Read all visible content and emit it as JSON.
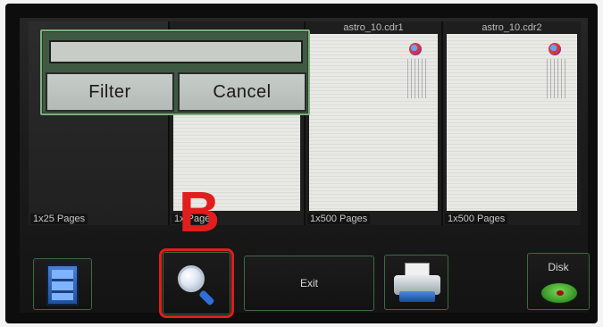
{
  "thumbnails": [
    {
      "name": "",
      "pages": "1x25 Pages"
    },
    {
      "name": "",
      "pages": "1x Pages"
    },
    {
      "name": "astro_10.cdr1",
      "pages": "1x500 Pages"
    },
    {
      "name": "astro_10.cdr2",
      "pages": "1x500 Pages"
    }
  ],
  "dialog": {
    "search_value": "",
    "filter_label": "Filter",
    "cancel_label": "Cancel"
  },
  "toolbar": {
    "exit_label": "Exit",
    "disk_label": "Disk",
    "film_icon": "film-strip-icon",
    "search_icon": "magnifier-icon",
    "print_icon": "printer-icon",
    "disk_icon": "disk-icon"
  },
  "annotation": {
    "marker": "B",
    "color": "#e11d1d"
  },
  "colors": {
    "accent_border": "#7fae7f",
    "dialog_bg": "#3f5a42"
  }
}
